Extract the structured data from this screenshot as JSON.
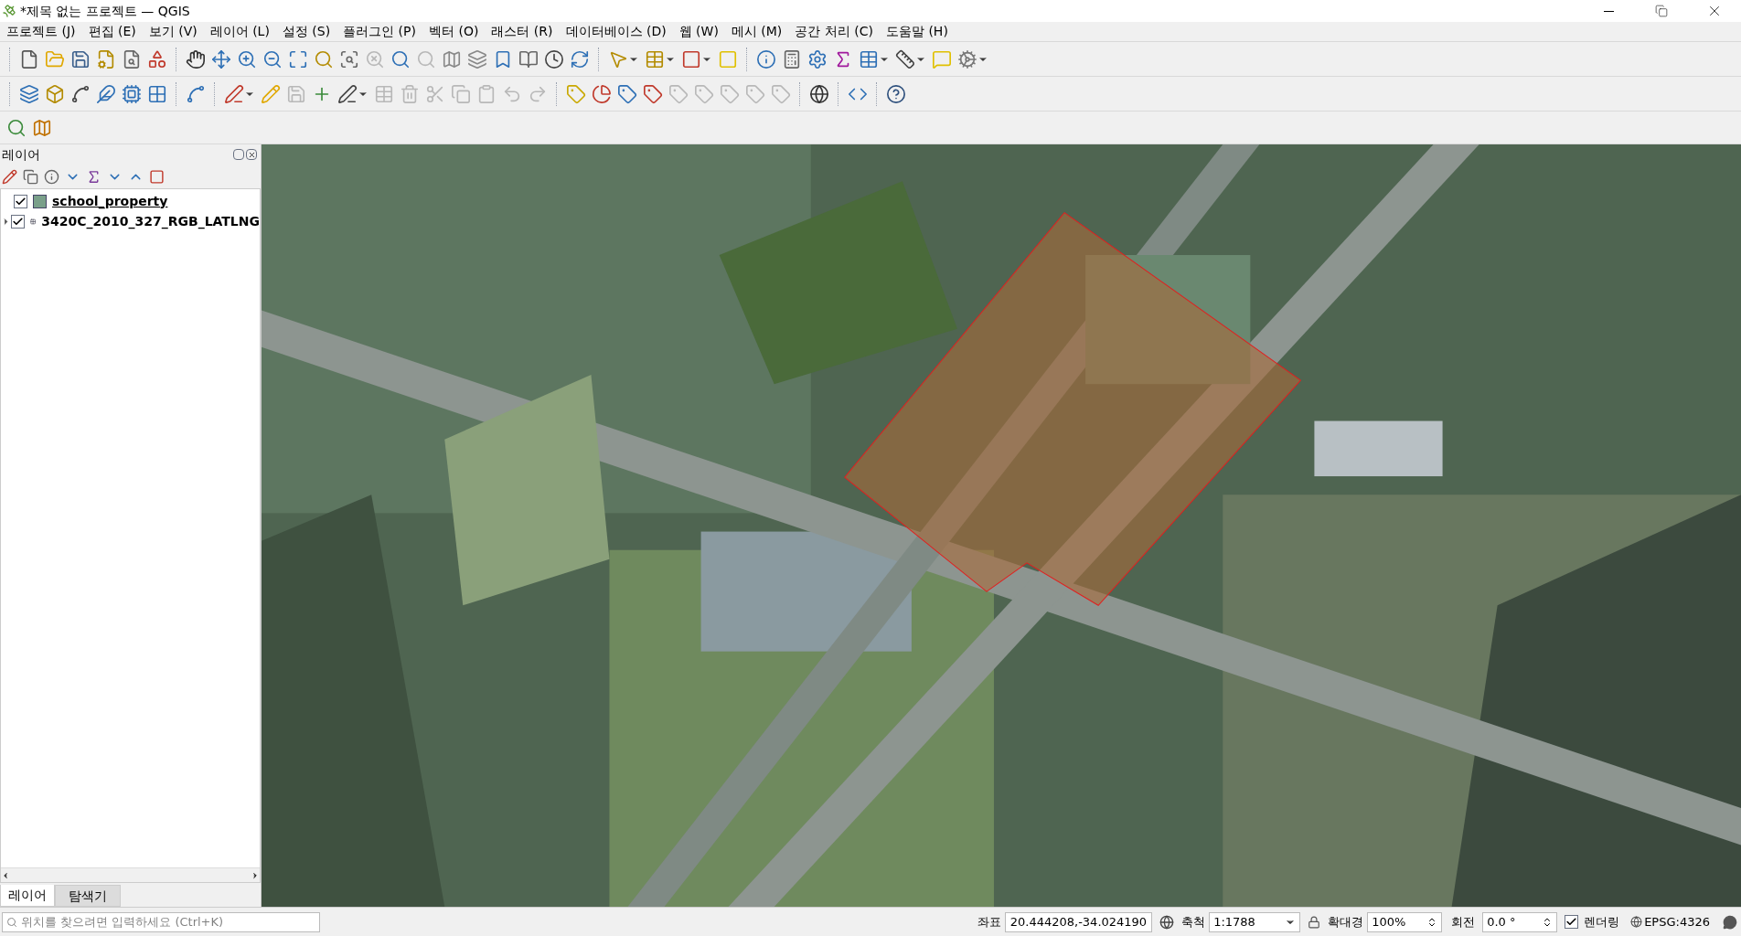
{
  "window": {
    "title": "*제목 없는 프로젝트 — QGIS"
  },
  "menu": [
    {
      "label": "프로젝트 (J)"
    },
    {
      "label": "편집 (E)"
    },
    {
      "label": "보기 (V)"
    },
    {
      "label": "레이어 (L)"
    },
    {
      "label": "설정 (S)"
    },
    {
      "label": "플러그인 (P)"
    },
    {
      "label": "벡터 (O)"
    },
    {
      "label": "래스터 (R)"
    },
    {
      "label": "데이터베이스 (D)"
    },
    {
      "label": "웹 (W)"
    },
    {
      "label": "메시 (M)"
    },
    {
      "label": "공간 처리 (C)"
    },
    {
      "label": "도움말 (H)"
    }
  ],
  "layers_panel": {
    "title": "레이어",
    "layers": [
      {
        "name": "school_property",
        "kind": "vector",
        "checked": true,
        "selected": true
      },
      {
        "name": "3420C_2010_327_RGB_LATLNG",
        "kind": "raster",
        "checked": true,
        "selected": false
      }
    ],
    "tabs": [
      {
        "label": "레이어",
        "selected": true
      },
      {
        "label": "탐색기",
        "selected": false
      }
    ]
  },
  "locator": {
    "placeholder": "위치를 찾으려면 입력하세요 (Ctrl+K)"
  },
  "status_bar": {
    "coordinate_label": "좌표",
    "coordinate": "20.444208,-34.024190",
    "scale_label": "축척",
    "scale": "1:1788",
    "magnifier_label": "확대경",
    "magnifier": "100%",
    "rotation_label": "회전",
    "rotation": "0.0 °",
    "render_label": "렌더링",
    "render_checked": true,
    "crs": "EPSG:4326"
  }
}
